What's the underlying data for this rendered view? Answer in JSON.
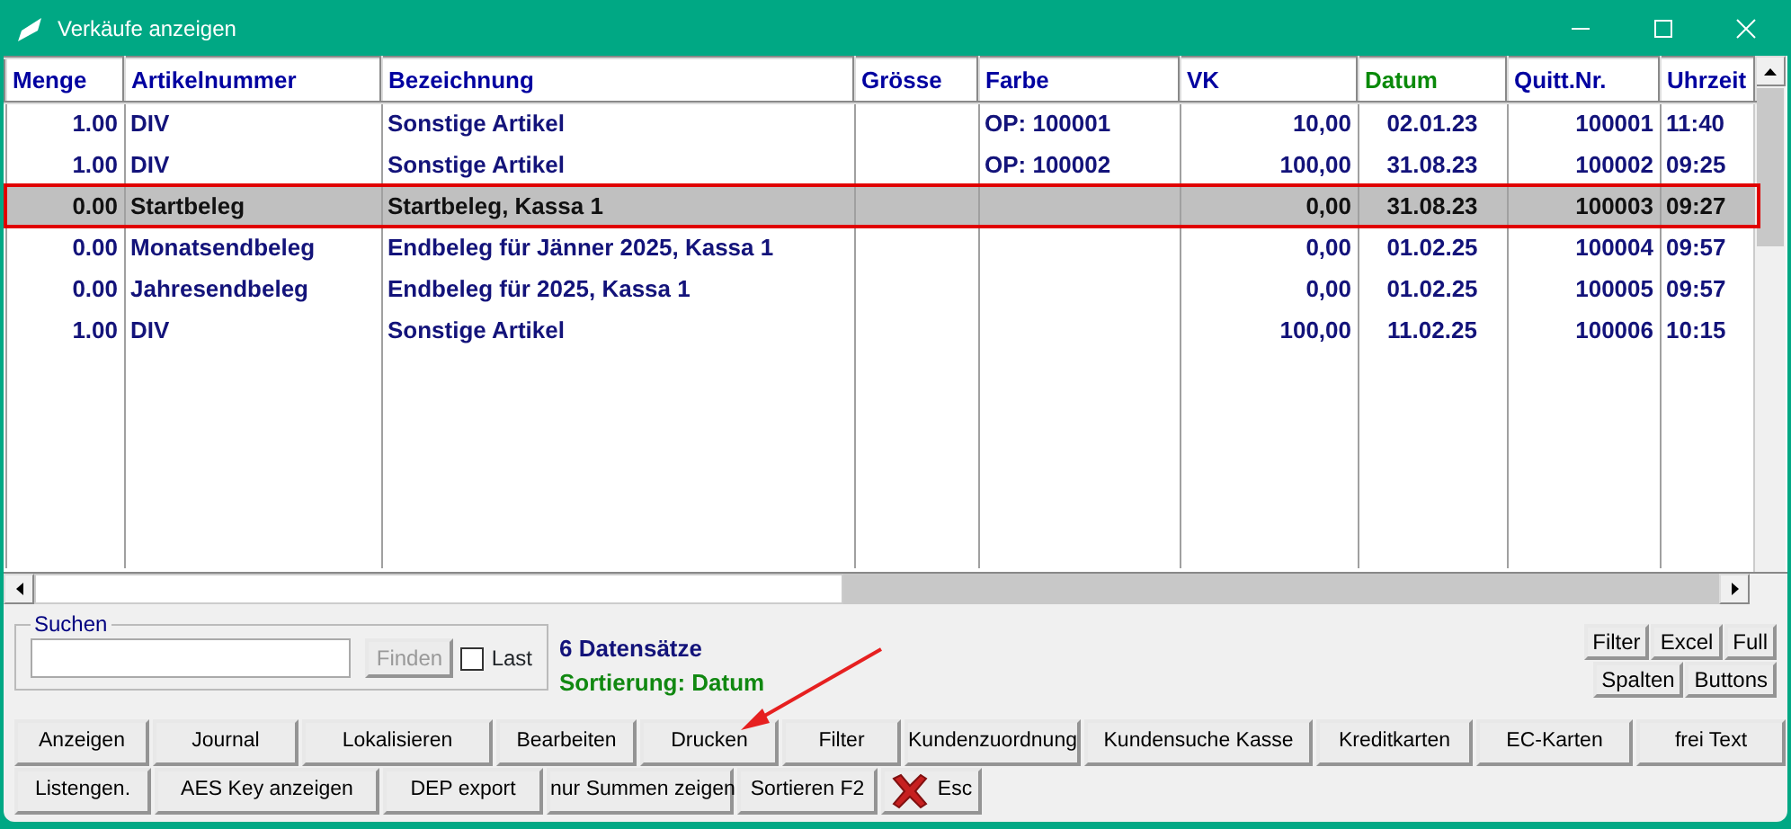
{
  "window": {
    "title": "Verkäufe anzeigen"
  },
  "table": {
    "columns": [
      {
        "label": "Menge",
        "kind": "normal"
      },
      {
        "label": "Artikelnummer",
        "kind": "normal"
      },
      {
        "label": "Bezeichnung",
        "kind": "normal"
      },
      {
        "label": "Grösse",
        "kind": "normal"
      },
      {
        "label": "Farbe",
        "kind": "normal"
      },
      {
        "label": "VK",
        "kind": "normal"
      },
      {
        "label": "Datum",
        "kind": "sorted"
      },
      {
        "label": "Quitt.Nr.",
        "kind": "normal"
      },
      {
        "label": "Uhrzeit",
        "kind": "normal"
      }
    ],
    "rows": [
      {
        "selected": false,
        "cells": [
          "1.00",
          "DIV",
          "Sonstige Artikel",
          "",
          "OP: 100001",
          "10,00",
          "02.01.23",
          "100001",
          "11:40"
        ]
      },
      {
        "selected": false,
        "cells": [
          "1.00",
          "DIV",
          "Sonstige Artikel",
          "",
          "OP: 100002",
          "100,00",
          "31.08.23",
          "100002",
          "09:25"
        ]
      },
      {
        "selected": true,
        "cells": [
          "0.00",
          "Startbeleg",
          "Startbeleg, Kassa 1",
          "",
          "",
          "0,00",
          "31.08.23",
          "100003",
          "09:27"
        ]
      },
      {
        "selected": false,
        "cells": [
          "0.00",
          "Monatsendbeleg",
          "Endbeleg für Jänner 2025, Kassa 1",
          "",
          "",
          "0,00",
          "01.02.25",
          "100004",
          "09:57"
        ]
      },
      {
        "selected": false,
        "cells": [
          "0.00",
          "Jahresendbeleg",
          "Endbeleg für 2025, Kassa 1",
          "",
          "",
          "0,00",
          "01.02.25",
          "100005",
          "09:57"
        ]
      },
      {
        "selected": false,
        "cells": [
          "1.00",
          "DIV",
          "Sonstige Artikel",
          "",
          "",
          "100,00",
          "11.02.25",
          "100006",
          "10:15"
        ]
      }
    ]
  },
  "search": {
    "legend": "Suchen",
    "find_button": "Finden",
    "find_disabled": true,
    "last_label": "Last",
    "last_checked": false
  },
  "record_count": "6 Datensätze",
  "sorting": "Sortierung: Datum",
  "small_buttons": [
    [
      "Filter",
      "Excel",
      "Full"
    ],
    [
      "Spalten",
      "Buttons"
    ]
  ],
  "buttons": [
    [
      {
        "label": "Anzeigen",
        "kind": "text"
      },
      {
        "label": "Journal",
        "kind": "text"
      },
      {
        "label": "Lokalisieren",
        "kind": "text"
      },
      {
        "label": "Bearbeiten",
        "kind": "text"
      },
      {
        "label": "Drucken",
        "kind": "text"
      },
      {
        "label": "Filter",
        "kind": "text"
      },
      {
        "label": "Kundenzuordnung",
        "kind": "text"
      },
      {
        "label": "Kundensuche Kasse",
        "kind": "text"
      },
      {
        "label": "Kreditkarten",
        "kind": "text"
      },
      {
        "label": "EC-Karten",
        "kind": "text"
      },
      {
        "label": "frei Text",
        "kind": "text"
      }
    ],
    [
      {
        "label": "Listengen.",
        "kind": "text"
      },
      {
        "label": "AES Key anzeigen",
        "kind": "text"
      },
      {
        "label": "DEP export",
        "kind": "text"
      },
      {
        "label": "nur Summen zeigen",
        "kind": "text"
      },
      {
        "label": "Sortieren F2",
        "kind": "text"
      },
      {
        "label": "Esc",
        "kind": "close"
      }
    ]
  ]
}
